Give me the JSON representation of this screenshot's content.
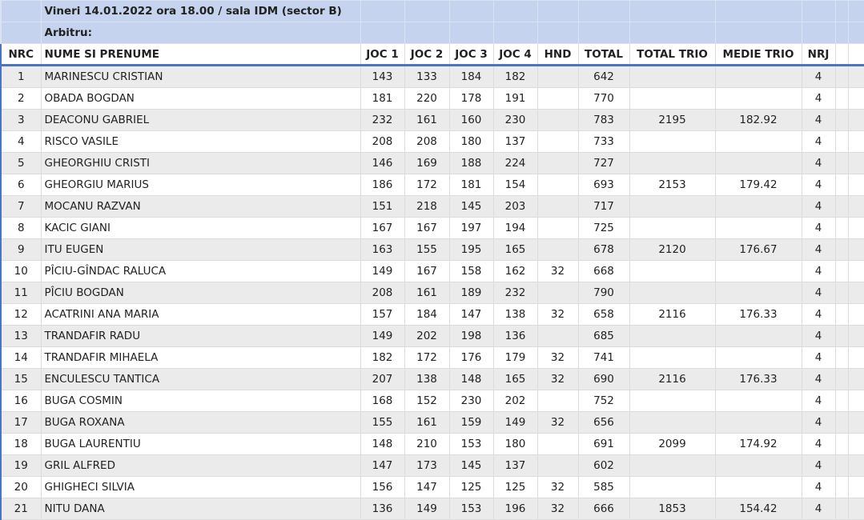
{
  "title": {
    "line1": "Vineri 14.01.2022 ora 18.00 / sala IDM (sector B)",
    "line2": "Arbitru:"
  },
  "headers": {
    "nrc": "NRC",
    "name": "NUME SI PRENUME",
    "g1": "JOC 1",
    "g2": "JOC 2",
    "g3": "JOC 3",
    "g4": "JOC 4",
    "hnd": "HND",
    "total": "TOTAL",
    "total_trio": "TOTAL TRIO",
    "medie_trio": "MEDIE TRIO",
    "nrj": "NRJ"
  },
  "rows": [
    {
      "nrc": "1",
      "name": "MARINESCU CRISTIAN",
      "g1": "143",
      "g2": "133",
      "g3": "184",
      "g4": "182",
      "hnd": "",
      "total": "642",
      "total_trio": "",
      "medie_trio": "",
      "nrj": "4"
    },
    {
      "nrc": "2",
      "name": "OBADA BOGDAN",
      "g1": "181",
      "g2": "220",
      "g3": "178",
      "g4": "191",
      "hnd": "",
      "total": "770",
      "total_trio": "",
      "medie_trio": "",
      "nrj": "4"
    },
    {
      "nrc": "3",
      "name": "DEACONU GABRIEL",
      "g1": "232",
      "g2": "161",
      "g3": "160",
      "g4": "230",
      "hnd": "",
      "total": "783",
      "total_trio": "2195",
      "medie_trio": "182.92",
      "nrj": "4"
    },
    {
      "nrc": "4",
      "name": "RISCO VASILE",
      "g1": "208",
      "g2": "208",
      "g3": "180",
      "g4": "137",
      "hnd": "",
      "total": "733",
      "total_trio": "",
      "medie_trio": "",
      "nrj": "4"
    },
    {
      "nrc": "5",
      "name": "GHEORGHIU CRISTI",
      "g1": "146",
      "g2": "169",
      "g3": "188",
      "g4": "224",
      "hnd": "",
      "total": "727",
      "total_trio": "",
      "medie_trio": "",
      "nrj": "4"
    },
    {
      "nrc": "6",
      "name": "GHEORGIU MARIUS",
      "g1": "186",
      "g2": "172",
      "g3": "181",
      "g4": "154",
      "hnd": "",
      "total": "693",
      "total_trio": "2153",
      "medie_trio": "179.42",
      "nrj": "4"
    },
    {
      "nrc": "7",
      "name": "MOCANU RAZVAN",
      "g1": "151",
      "g2": "218",
      "g3": "145",
      "g4": "203",
      "hnd": "",
      "total": "717",
      "total_trio": "",
      "medie_trio": "",
      "nrj": "4"
    },
    {
      "nrc": "8",
      "name": "KACIC GIANI",
      "g1": "167",
      "g2": "167",
      "g3": "197",
      "g4": "194",
      "hnd": "",
      "total": "725",
      "total_trio": "",
      "medie_trio": "",
      "nrj": "4"
    },
    {
      "nrc": "9",
      "name": "ITU EUGEN",
      "g1": "163",
      "g2": "155",
      "g3": "195",
      "g4": "165",
      "hnd": "",
      "total": "678",
      "total_trio": "2120",
      "medie_trio": "176.67",
      "nrj": "4"
    },
    {
      "nrc": "10",
      "name": "PÎCIU-GÎNDAC RALUCA",
      "g1": "149",
      "g2": "167",
      "g3": "158",
      "g4": "162",
      "hnd": "32",
      "total": "668",
      "total_trio": "",
      "medie_trio": "",
      "nrj": "4"
    },
    {
      "nrc": "11",
      "name": "PÎCIU BOGDAN",
      "g1": "208",
      "g2": "161",
      "g3": "189",
      "g4": "232",
      "hnd": "",
      "total": "790",
      "total_trio": "",
      "medie_trio": "",
      "nrj": "4"
    },
    {
      "nrc": "12",
      "name": "ACATRINI ANA MARIA",
      "g1": "157",
      "g2": "184",
      "g3": "147",
      "g4": "138",
      "hnd": "32",
      "total": "658",
      "total_trio": "2116",
      "medie_trio": "176.33",
      "nrj": "4"
    },
    {
      "nrc": "13",
      "name": "TRANDAFIR RADU",
      "g1": "149",
      "g2": "202",
      "g3": "198",
      "g4": "136",
      "hnd": "",
      "total": "685",
      "total_trio": "",
      "medie_trio": "",
      "nrj": "4"
    },
    {
      "nrc": "14",
      "name": "TRANDAFIR MIHAELA",
      "g1": "182",
      "g2": "172",
      "g3": "176",
      "g4": "179",
      "hnd": "32",
      "total": "741",
      "total_trio": "",
      "medie_trio": "",
      "nrj": "4"
    },
    {
      "nrc": "15",
      "name": "ENCULESCU TANTICA",
      "g1": "207",
      "g2": "138",
      "g3": "148",
      "g4": "165",
      "hnd": "32",
      "total": "690",
      "total_trio": "2116",
      "medie_trio": "176.33",
      "nrj": "4"
    },
    {
      "nrc": "16",
      "name": "BUGA COSMIN",
      "g1": "168",
      "g2": "152",
      "g3": "230",
      "g4": "202",
      "hnd": "",
      "total": "752",
      "total_trio": "",
      "medie_trio": "",
      "nrj": "4"
    },
    {
      "nrc": "17",
      "name": "BUGA ROXANA",
      "g1": "155",
      "g2": "161",
      "g3": "159",
      "g4": "149",
      "hnd": "32",
      "total": "656",
      "total_trio": "",
      "medie_trio": "",
      "nrj": "4"
    },
    {
      "nrc": "18",
      "name": "BUGA LAURENTIU",
      "g1": "148",
      "g2": "210",
      "g3": "153",
      "g4": "180",
      "hnd": "",
      "total": "691",
      "total_trio": "2099",
      "medie_trio": "174.92",
      "nrj": "4"
    },
    {
      "nrc": "19",
      "name": "GRIL ALFRED",
      "g1": "147",
      "g2": "173",
      "g3": "145",
      "g4": "137",
      "hnd": "",
      "total": "602",
      "total_trio": "",
      "medie_trio": "",
      "nrj": "4"
    },
    {
      "nrc": "20",
      "name": "GHIGHECI SILVIA",
      "g1": "156",
      "g2": "147",
      "g3": "125",
      "g4": "125",
      "hnd": "32",
      "total": "585",
      "total_trio": "",
      "medie_trio": "",
      "nrj": "4"
    },
    {
      "nrc": "21",
      "name": "NITU DANA",
      "g1": "136",
      "g2": "149",
      "g3": "153",
      "g4": "196",
      "hnd": "32",
      "total": "666",
      "total_trio": "1853",
      "medie_trio": "154.42",
      "nrj": "4"
    }
  ]
}
